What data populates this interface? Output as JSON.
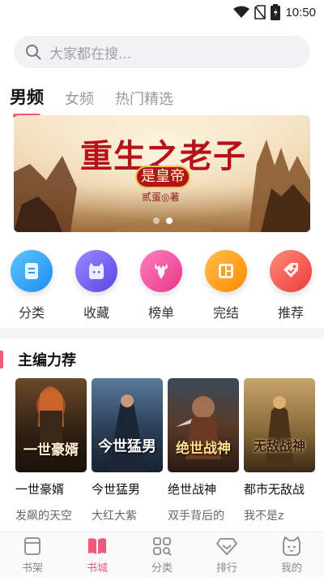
{
  "status_bar": {
    "time": "10:50"
  },
  "search": {
    "placeholder": "大家都在搜..."
  },
  "tabs": [
    {
      "label": "男频",
      "active": true
    },
    {
      "label": "女频",
      "active": false
    },
    {
      "label": "热门精选",
      "active": false
    }
  ],
  "banner": {
    "title": "重生之老子",
    "badge": "是皇帝",
    "author": "贰蛋◎著",
    "page_count": 2,
    "active_page": 1
  },
  "categories": [
    {
      "label": "分类",
      "icon": "document-icon",
      "color": "#2a9df4"
    },
    {
      "label": "收藏",
      "icon": "cat-face-icon",
      "color": "#6a5cf0"
    },
    {
      "label": "榜单",
      "icon": "deer-icon",
      "color": "#f04f9a"
    },
    {
      "label": "完结",
      "icon": "book-grid-icon",
      "color": "#ff9f1c"
    },
    {
      "label": "推荐",
      "icon": "tag-icon",
      "color": "#f5554a"
    }
  ],
  "section": {
    "title": "主编力荐"
  },
  "books": [
    {
      "title": "一世豪婿",
      "author": "发飙的天空",
      "cover_text": "一世豪婿"
    },
    {
      "title": "今世猛男",
      "author": "大红大紫",
      "cover_text": "今世猛男"
    },
    {
      "title": "绝世战神",
      "author": "双手背后的",
      "cover_text": "绝世战神"
    },
    {
      "title": "都市无敌战",
      "author": "我不是z",
      "cover_text": "无敌战神"
    }
  ],
  "bottom_nav": [
    {
      "label": "书架",
      "icon": "bookshelf-icon",
      "active": false
    },
    {
      "label": "书城",
      "icon": "open-book-icon",
      "active": true
    },
    {
      "label": "分类",
      "icon": "category-grid-icon",
      "active": false
    },
    {
      "label": "排行",
      "icon": "diamond-icon",
      "active": false
    },
    {
      "label": "我的",
      "icon": "profile-cat-icon",
      "active": false
    }
  ],
  "colors": {
    "accent": "#f0597c",
    "search_bg": "#f2f2f4",
    "divider": "#f3f3f5"
  }
}
